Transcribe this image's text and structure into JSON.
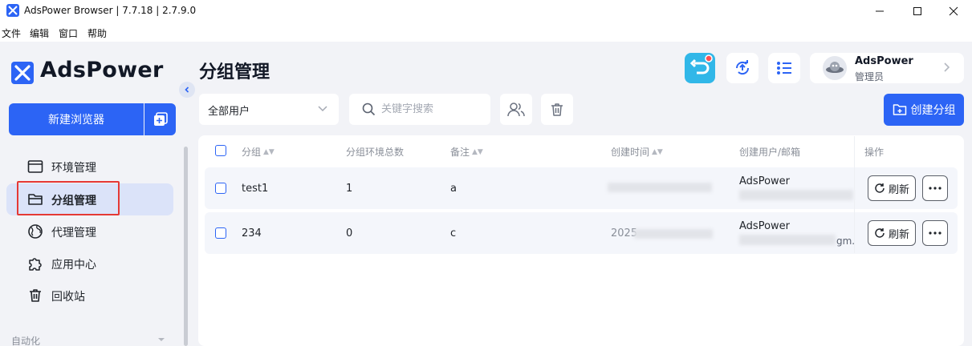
{
  "window": {
    "title": "AdsPower Browser | 7.7.18 | 2.7.9.0",
    "controls": [
      "minimize",
      "maximize",
      "close"
    ]
  },
  "menu": [
    "文件",
    "编辑",
    "窗口",
    "帮助"
  ],
  "sidebar": {
    "logo_text": "AdsPower",
    "new_browser_label": "新建浏览器",
    "items": [
      {
        "label": "环境管理",
        "icon": "browser-window-icon"
      },
      {
        "label": "分组管理",
        "icon": "folder-icon",
        "active": true
      },
      {
        "label": "代理管理",
        "icon": "globe-icon"
      },
      {
        "label": "应用中心",
        "icon": "puzzle-icon"
      },
      {
        "label": "回收站",
        "icon": "trash-icon"
      }
    ],
    "section_label": "自动化"
  },
  "header": {
    "page_title": "分组管理",
    "profile": {
      "name": "AdsPower",
      "role": "管理员"
    }
  },
  "toolbar": {
    "filter_value": "全部用户",
    "search_placeholder": "关键字搜索",
    "create_label": "创建分组"
  },
  "table": {
    "columns": [
      "分组",
      "分组环境总数",
      "备注",
      "创建时间",
      "创建用户/邮箱",
      "操作"
    ],
    "rows": [
      {
        "name": "test1",
        "count": "1",
        "note": "a",
        "created": "",
        "user": "AdsPower",
        "email_partial": ""
      },
      {
        "name": "234",
        "count": "0",
        "note": "c",
        "created": "2025",
        "user": "AdsPower",
        "email_partial": "gm."
      }
    ],
    "refresh_label": "刷新"
  },
  "colors": {
    "accent": "#2c64f5",
    "highlight_box": "#e53935",
    "active_bg": "#dbe3f9"
  }
}
